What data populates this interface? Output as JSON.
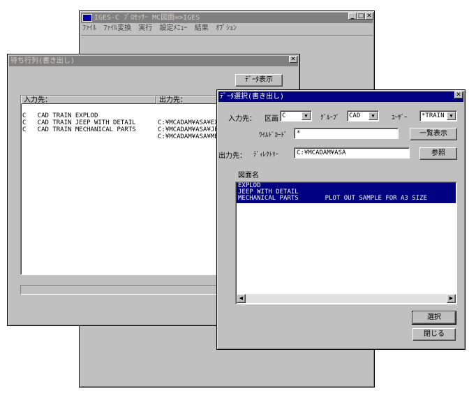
{
  "main_window": {
    "title": "IGES-C ﾌﾟﾛｾｯｻｰ MC図面=>IGES",
    "menu": [
      "ﾌｧｲﾙ",
      "ﾌｧｲﾙ変換",
      "実行",
      "設定ﾒﾆｭｰ",
      "結果",
      "ｵﾌﾟｼｮﾝ"
    ]
  },
  "queue_window": {
    "title": "待ち行列(書き出し)",
    "data_display_button": "ﾃﾞｰﾀ表示",
    "columns": [
      "入力先：",
      "出力先："
    ],
    "rows": [
      {
        "input": "C   CAD TRAIN EXPLOD",
        "output": "C:¥MCADAM¥ASA¥EXPLO"
      },
      {
        "input": "C   CAD TRAIN JEEP WITH DETAIL",
        "output": "C:¥MCADAM¥ASA¥JEEP"
      },
      {
        "input": "C   CAD TRAIN MECHANICAL PARTS",
        "output": "C:¥MCADAM¥ASA¥MECHA"
      }
    ]
  },
  "select_dialog": {
    "title": "ﾃﾞｰﾀ選択(書き出し)",
    "input_label": "入力先：",
    "section_label": "区画",
    "section_value": "C",
    "group_label": "ｸﾞﾙｰﾌﾟ",
    "group_value": "CAD",
    "user_label": "ﾕｰｻﾞｰ",
    "user_value": "*TRAIN",
    "wildcard_label": "ﾜｲﾙﾄﾞｶｰﾄﾞ",
    "wildcard_value": "*",
    "list_button": "一覧表示",
    "output_label": "出力先：",
    "directory_label": "ﾃﾞｨﾚｸﾄﾘｰ",
    "directory_value": "C:¥MCADAM¥ASA",
    "browse_button": "参照",
    "drawing_name_label": "図面名",
    "drawings": [
      "EXPLOD",
      "JEEP WITH DETAIL",
      "MECHANICAL PARTS       PLOT OUT SAMPLE FOR A3 SIZE"
    ],
    "select_button": "選択",
    "close_button": "閉じる"
  }
}
